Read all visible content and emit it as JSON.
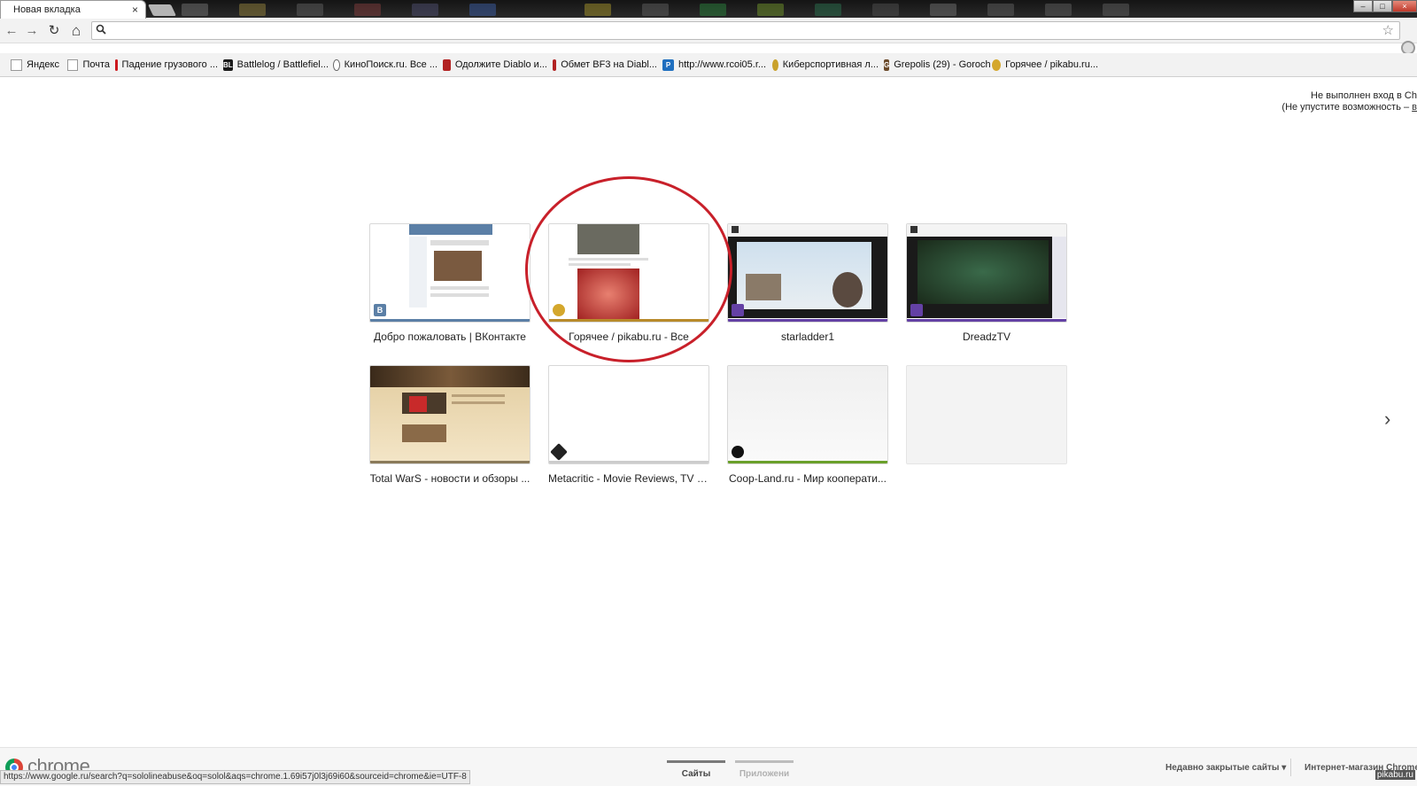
{
  "tab": {
    "title": "Новая вкладка",
    "close": "×"
  },
  "window_controls": {
    "minimize": "–",
    "maximize": "□",
    "close": "×"
  },
  "toolbar": {
    "back": "←",
    "forward": "→",
    "reload": "↻",
    "home": "⌂",
    "omnibox_value": "",
    "omnibox_placeholder": ""
  },
  "bookmarks": [
    {
      "label": "Яндекс",
      "icon": "page-icon"
    },
    {
      "label": "Почта",
      "icon": "page-icon"
    },
    {
      "label": "Падение грузового ...",
      "icon": "youtube-icon"
    },
    {
      "label": "Battlelog / Battlefiel...",
      "icon": "battlelog-icon",
      "glyph": "BL"
    },
    {
      "label": "КиноПоиск.ru. Все ...",
      "icon": "kinopoisk-icon"
    },
    {
      "label": "Одолжите Diablo и...",
      "icon": "diablo-icon"
    },
    {
      "label": "Обмет BF3 на Diabl...",
      "icon": "diablo-icon"
    },
    {
      "label": "http://www.rcoi05.r...",
      "icon": "p-icon",
      "glyph": "P"
    },
    {
      "label": "Киберспортивная л...",
      "icon": "cybersport-icon"
    },
    {
      "label": "Grepolis (29) - Goroch",
      "icon": "grepolis-icon",
      "glyph": "G"
    },
    {
      "label": "Горячее / pikabu.ru...",
      "icon": "pikabu-icon"
    }
  ],
  "signin": {
    "line1": "Не выполнен вход в Ch",
    "line2": "(Не упустите возможность – ",
    "link": "в"
  },
  "most_visited": [
    {
      "label": "Добро пожаловать | ВКонтакте",
      "favicon": "vk-icon",
      "glyph": "В",
      "bar_color": "#5b7fa6"
    },
    {
      "label": "Горячее / pikabu.ru - Все",
      "favicon": "pikabu-icon",
      "glyph": "",
      "bar_color": "#b88a2a"
    },
    {
      "label": "starladder1",
      "favicon": "twitch-icon",
      "glyph": "",
      "bar_color": "#6441a5"
    },
    {
      "label": "DreadzTV",
      "favicon": "twitch-icon",
      "glyph": "",
      "bar_color": "#6441a5"
    },
    {
      "label": "Total WarS - новости и обзоры ...",
      "favicon": "totalwars-icon",
      "glyph": "",
      "bar_color": "#8a7a5a"
    },
    {
      "label": "Metacritic - Movie Reviews, TV R...",
      "favicon": "metacritic-icon",
      "glyph": "",
      "bar_color": "#cccccc"
    },
    {
      "label": "Coop-Land.ru - Мир кооперати...",
      "favicon": "coopland-icon",
      "glyph": "",
      "bar_color": "#6aa02a"
    },
    {
      "label": "",
      "favicon": "",
      "glyph": "",
      "bar_color": ""
    }
  ],
  "next_page": "›",
  "footer": {
    "brand": "chrome",
    "tabs": [
      {
        "label": "Сайты",
        "active": true
      },
      {
        "label": "Приложени",
        "active": false
      }
    ],
    "recent": "Недавно закрытые сайты ▾",
    "store": "Интернет-магазин Chrome"
  },
  "status_url": "https://www.google.ru/search?q=sololineabuse&oq=solol&aqs=chrome.1.69i57j0l3j69i60&sourceid=chrome&ie=UTF-8",
  "watermark": "pikabu.ru",
  "colors": {
    "annotation_circle": "#c8202a"
  }
}
